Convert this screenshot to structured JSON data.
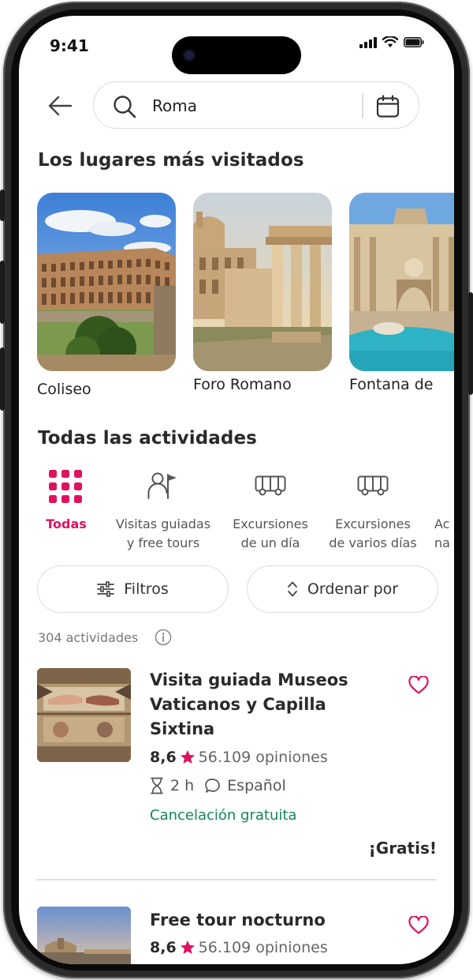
{
  "status_bar": {
    "time": "9:41"
  },
  "search": {
    "value": "Roma"
  },
  "popular": {
    "title": "Los lugares más visitados",
    "places": [
      {
        "name": "Coliseo"
      },
      {
        "name": "Foro Romano"
      },
      {
        "name": "Fontana de"
      }
    ]
  },
  "activities": {
    "title": "Todas las actividades",
    "categories": [
      {
        "label": "Todas",
        "icon": "grid-icon",
        "active": true
      },
      {
        "label": "Visitas guiadas\ny free tours",
        "icon": "guide-flag-icon",
        "active": false
      },
      {
        "label": "Excursiones\nde un día",
        "icon": "bus-icon",
        "active": false
      },
      {
        "label": "Excursiones\nde varios días",
        "icon": "bus-icon",
        "active": false
      },
      {
        "label": "Ac\nna",
        "icon": "none",
        "active": false
      }
    ],
    "filters_label": "Filtros",
    "sort_label": "Ordenar por",
    "count_text": "304 actividades"
  },
  "results": [
    {
      "title": "Visita guiada Museos Vaticanos y Capilla Sixtina",
      "rating": "8,6",
      "reviews": "56.109 opiniones",
      "duration": "2 h",
      "language": "Español",
      "cancellation": "Cancelación gratuita",
      "price": "¡Gratis!"
    },
    {
      "title": "Free tour nocturno",
      "rating": "8,6",
      "reviews": "56.109 opiniones"
    }
  ],
  "colors": {
    "accent": "#e0115f",
    "green": "#12865d",
    "border": "#dcdcdc"
  }
}
